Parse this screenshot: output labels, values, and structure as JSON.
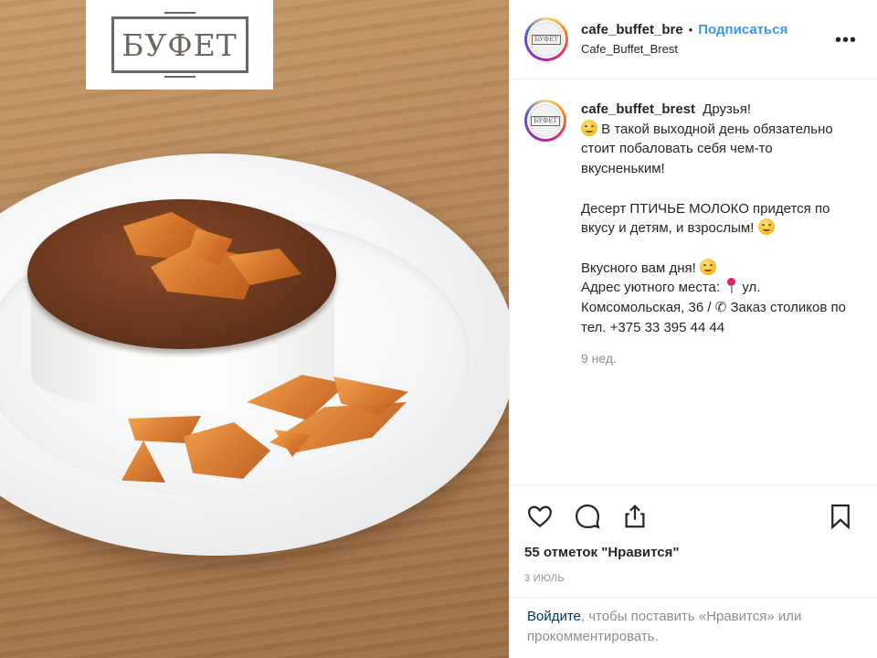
{
  "photo": {
    "logo_text": "БУФЕТ",
    "logo_color": "#6d6762",
    "subject": "dessert-on-plate"
  },
  "header": {
    "username": "cafe_buffet_bre",
    "separator": "•",
    "follow_label": "Подписаться",
    "location": "Cafe_Buffet_Brest",
    "more_label": "•••",
    "avatar_text": "БУФЕТ"
  },
  "caption": {
    "username": "cafe_buffet_brest",
    "line_greeting": "Друзья!",
    "line_1_after_emoji": "В такой выходной день обязательно стоит побаловать себя чем-то вкусненьким!",
    "line_2": "Десерт ПТИЧЬЕ МОЛОКО придется по вкусу и детям, и взрослым!",
    "line_3": "Вкусного вам дня!",
    "line_4_a": "Адрес уютного места:",
    "line_4_b": "ул. Комсомольская, 36 /",
    "line_4_c": "Заказ столиков по тел. +375 33 395 44 44",
    "ago": "9 нед.",
    "avatar_text": "БУФЕТ"
  },
  "actions": {
    "icons": [
      "heart-icon",
      "comment-icon",
      "share-icon",
      "bookmark-icon"
    ],
    "likes": "55 отметок \"Нравится\"",
    "date": "3 июль"
  },
  "login_prompt": {
    "link": "Войдите",
    "text": ", чтобы поставить «Нравится» или прокомментировать."
  },
  "colors": {
    "accent": "#3897f0",
    "link_dark": "#003569",
    "muted": "#8e8e8e",
    "text": "#262626",
    "border": "#efefef"
  }
}
